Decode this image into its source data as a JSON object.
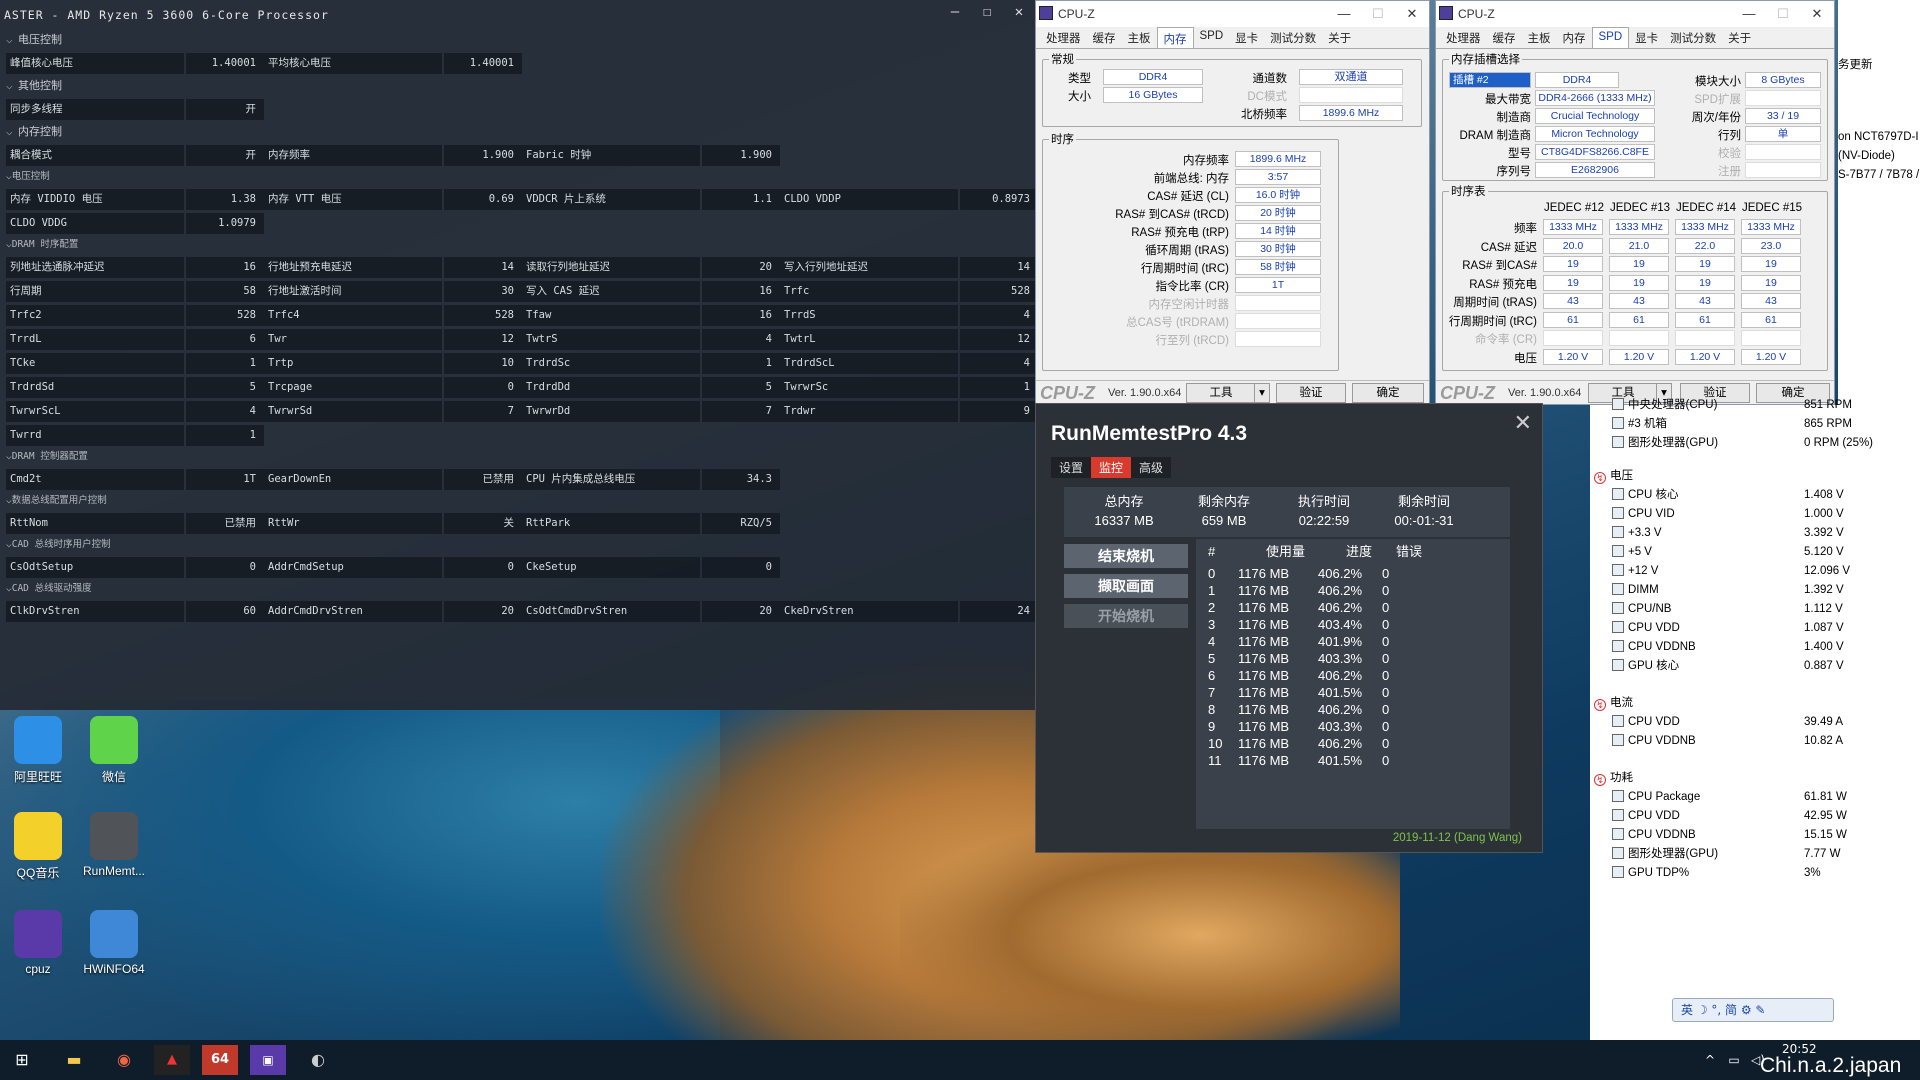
{
  "ryzen_master": {
    "title": "ASTER - AMD Ryzen 5 3600 6-Core Processor",
    "sections": [
      {
        "heading": "电压控制",
        "size": "big",
        "rows": [
          [
            [
              "峰值核心电压",
              "1.40001"
            ],
            [
              "平均核心电压",
              "1.40001"
            ]
          ]
        ]
      },
      {
        "heading": "其他控制",
        "size": "big",
        "rows": [
          [
            [
              "同步多线程",
              "开"
            ]
          ]
        ]
      },
      {
        "heading": "内存控制",
        "size": "big",
        "rows": [
          [
            [
              "耦合模式",
              "开"
            ],
            [
              "内存频率",
              "1.900"
            ],
            [
              "Fabric 时钟",
              "1.900"
            ]
          ]
        ]
      },
      {
        "heading": "电压控制",
        "size": "small",
        "rows": [
          [
            [
              "内存 VIDDIO 电压",
              "1.38"
            ],
            [
              "内存 VTT 电压",
              "0.69"
            ],
            [
              "VDDCR 片上系统",
              "1.1"
            ],
            [
              "CLDO VDDP",
              "0.8973"
            ]
          ],
          [
            [
              "CLDO VDDG",
              "1.0979"
            ]
          ]
        ]
      },
      {
        "heading": "DRAM 时序配置",
        "size": "small",
        "rows": [
          [
            [
              "列地址选通脉冲延迟",
              "16"
            ],
            [
              "行地址预充电延迟",
              "14"
            ],
            [
              "读取行列地址延迟",
              "20"
            ],
            [
              "写入行列地址延迟",
              "14"
            ]
          ],
          [
            [
              "行周期",
              "58"
            ],
            [
              "行地址激活时间",
              "30"
            ],
            [
              "写入 CAS 延迟",
              "16"
            ],
            [
              "Trfc",
              "528"
            ]
          ],
          [
            [
              "Trfc2",
              "528"
            ],
            [
              "Trfc4",
              "528"
            ],
            [
              "Tfaw",
              "16"
            ],
            [
              "TrrdS",
              "4"
            ]
          ],
          [
            [
              "TrrdL",
              "6"
            ],
            [
              "Twr",
              "12"
            ],
            [
              "TwtrS",
              "4"
            ],
            [
              "TwtrL",
              "12"
            ]
          ],
          [
            [
              "TCke",
              "1"
            ],
            [
              "Trtp",
              "10"
            ],
            [
              "TrdrdSc",
              "1"
            ],
            [
              "TrdrdScL",
              "4"
            ]
          ],
          [
            [
              "TrdrdSd",
              "5"
            ],
            [
              "Trcpage",
              "0"
            ],
            [
              "TrdrdDd",
              "5"
            ],
            [
              "TwrwrSc",
              "1"
            ]
          ],
          [
            [
              "TwrwrScL",
              "4"
            ],
            [
              "TwrwrSd",
              "7"
            ],
            [
              "TwrwrDd",
              "7"
            ],
            [
              "Trdwr",
              "9"
            ]
          ],
          [
            [
              "Twrrd",
              "1"
            ]
          ]
        ]
      },
      {
        "heading": "DRAM 控制器配置",
        "size": "small",
        "rows": [
          [
            [
              "Cmd2t",
              "1T"
            ],
            [
              "GearDownEn",
              "已禁用"
            ],
            [
              "CPU 片内集成总线电压",
              "34.3"
            ]
          ]
        ]
      },
      {
        "heading": "数据总线配置用户控制",
        "size": "small",
        "rows": [
          [
            [
              "RttNom",
              "已禁用"
            ],
            [
              "RttWr",
              "关"
            ],
            [
              "RttPark",
              "RZQ/5"
            ]
          ]
        ]
      },
      {
        "heading": "CAD 总线时序用户控制",
        "size": "small",
        "rows": [
          [
            [
              "CsOdtSetup",
              "0"
            ],
            [
              "AddrCmdSetup",
              "0"
            ],
            [
              "CkeSetup",
              "0"
            ]
          ]
        ]
      },
      {
        "heading": "CAD 总线驱动强度",
        "size": "small",
        "rows": [
          [
            [
              "ClkDrvStren",
              "60"
            ],
            [
              "AddrCmdDrvStren",
              "20"
            ],
            [
              "CsOdtCmdDrvStren",
              "20"
            ],
            [
              "CkeDrvStren",
              "24"
            ]
          ]
        ]
      }
    ]
  },
  "cpuz1": {
    "title": "CPU-Z",
    "tabs": [
      "处理器",
      "缓存",
      "主板",
      "内存",
      "SPD",
      "显卡",
      "测试分数",
      "关于"
    ],
    "active_tab": 3,
    "general_label": "常规",
    "type_label": "类型",
    "type": "DDR4",
    "size_label": "大小",
    "size": "16 GBytes",
    "channels_label": "通道数",
    "channels": "双通道",
    "dc_label": "DC模式",
    "nb_label": "北桥频率",
    "nb": "1899.6 MHz",
    "timing_label": "时序",
    "timings": [
      {
        "k": "内存频率",
        "v": "1899.6 MHz",
        "dim": false
      },
      {
        "k": "前端总线: 内存",
        "v": "3:57",
        "dim": false
      },
      {
        "k": "CAS# 延迟 (CL)",
        "v": "16.0 时钟",
        "dim": false
      },
      {
        "k": "RAS# 到CAS# (tRCD)",
        "v": "20 时钟",
        "dim": false
      },
      {
        "k": "RAS# 预充电 (tRP)",
        "v": "14 时钟",
        "dim": false
      },
      {
        "k": "循环周期 (tRAS)",
        "v": "30 时钟",
        "dim": false
      },
      {
        "k": "行周期时间 (tRC)",
        "v": "58 时钟",
        "dim": false
      },
      {
        "k": "指令比率 (CR)",
        "v": "1T",
        "dim": false
      },
      {
        "k": "内存空闲计时器",
        "v": "",
        "dim": true
      },
      {
        "k": "总CAS号 (tRDRAM)",
        "v": "",
        "dim": true
      },
      {
        "k": "行至列 (tRCD)",
        "v": "",
        "dim": true
      }
    ],
    "footer_logo": "CPU-Z",
    "version": "Ver. 1.90.0.x64",
    "tools": "工具",
    "validate": "验证",
    "ok": "确定"
  },
  "cpuz2": {
    "title": "CPU-Z",
    "tabs": [
      "处理器",
      "缓存",
      "主板",
      "内存",
      "SPD",
      "显卡",
      "测试分数",
      "关于"
    ],
    "active_tab": 4,
    "slot_group": "内存插槽选择",
    "slot": "插槽 #2",
    "mem_type": "DDR4",
    "module_size_label": "模块大小",
    "module_size": "8 GBytes",
    "max_bw_label": "最大带宽",
    "max_bw": "DDR4-2666 (1333 MHz)",
    "spd_ext_label": "SPD扩展",
    "maker_label": "制造商",
    "maker": "Crucial Technology",
    "week_label": "周次/年份",
    "week": "33 / 19",
    "dram_maker_label": "DRAM 制造商",
    "dram_maker": "Micron Technology",
    "rank_label": "行列",
    "rank": "单",
    "part_label": "型号",
    "part": "CT8G4DFS8266.C8FE",
    "check_label": "校验",
    "serial_label": "序列号",
    "serial": "E2682906",
    "reg_label": "注册",
    "table_label": "时序表",
    "jedec_headers": [
      "JEDEC #12",
      "JEDEC #13",
      "JEDEC #14",
      "JEDEC #15"
    ],
    "jedec_rows": [
      {
        "k": "频率",
        "v": [
          "1333 MHz",
          "1333 MHz",
          "1333 MHz",
          "1333 MHz"
        ]
      },
      {
        "k": "CAS# 延迟",
        "v": [
          "20.0",
          "21.0",
          "22.0",
          "23.0"
        ]
      },
      {
        "k": "RAS# 到CAS#",
        "v": [
          "19",
          "19",
          "19",
          "19"
        ]
      },
      {
        "k": "RAS# 预充电",
        "v": [
          "19",
          "19",
          "19",
          "19"
        ]
      },
      {
        "k": "周期时间 (tRAS)",
        "v": [
          "43",
          "43",
          "43",
          "43"
        ]
      },
      {
        "k": "行周期时间 (tRC)",
        "v": [
          "61",
          "61",
          "61",
          "61"
        ]
      },
      {
        "k": "命令率 (CR)",
        "v": [
          "",
          "",
          "",
          ""
        ],
        "dim": true
      },
      {
        "k": "电压",
        "v": [
          "1.20 V",
          "1.20 V",
          "1.20 V",
          "1.20 V"
        ]
      }
    ],
    "footer_logo": "CPU-Z",
    "version": "Ver. 1.90.0.x64",
    "tools": "工具",
    "validate": "验证",
    "ok": "确定"
  },
  "runmemtest": {
    "title": "RunMemtestPro 4.3",
    "tabs": [
      "设置",
      "监控",
      "高级"
    ],
    "active_tab": 1,
    "summary_headers": [
      "总内存",
      "剩余内存",
      "执行时间",
      "剩余时间"
    ],
    "summary_values": [
      "16337 MB",
      "659 MB",
      "02:22:59",
      "00:-01:-31"
    ],
    "buttons": [
      "结束烧机",
      "撷取画面",
      "开始烧机"
    ],
    "table_headers": [
      "#",
      "使用量",
      "进度",
      "错误"
    ],
    "rows": [
      [
        "0",
        "1176 MB",
        "406.2%",
        "0"
      ],
      [
        "1",
        "1176 MB",
        "406.2%",
        "0"
      ],
      [
        "2",
        "1176 MB",
        "406.2%",
        "0"
      ],
      [
        "3",
        "1176 MB",
        "403.4%",
        "0"
      ],
      [
        "4",
        "1176 MB",
        "401.9%",
        "0"
      ],
      [
        "5",
        "1176 MB",
        "403.3%",
        "0"
      ],
      [
        "6",
        "1176 MB",
        "406.2%",
        "0"
      ],
      [
        "7",
        "1176 MB",
        "401.5%",
        "0"
      ],
      [
        "8",
        "1176 MB",
        "406.2%",
        "0"
      ],
      [
        "9",
        "1176 MB",
        "403.3%",
        "0"
      ],
      [
        "10",
        "1176 MB",
        "406.2%",
        "0"
      ],
      [
        "11",
        "1176 MB",
        "401.5%",
        "0"
      ]
    ],
    "footer": "2019-11-12 (Dang Wang)"
  },
  "hwinfo_partial": {
    "right_top_texts": [
      "务更新",
      "on NCT6797D-I",
      "(NV-Diode)",
      "S-7B77 / 7B78 /"
    ],
    "fans": [
      {
        "k": "中央处理器(CPU)",
        "v": "851 RPM"
      },
      {
        "k": "#3 机箱",
        "v": "865 RPM"
      },
      {
        "k": "图形处理器(GPU)",
        "v": "0 RPM  (25%)"
      }
    ],
    "voltage_heading": "电压",
    "voltages": [
      {
        "k": "CPU 核心",
        "v": "1.408 V"
      },
      {
        "k": "CPU VID",
        "v": "1.000 V"
      },
      {
        "k": "+3.3 V",
        "v": "3.392 V"
      },
      {
        "k": "+5 V",
        "v": "5.120 V"
      },
      {
        "k": "+12 V",
        "v": "12.096 V"
      },
      {
        "k": "DIMM",
        "v": "1.392 V"
      },
      {
        "k": "CPU/NB",
        "v": "1.112 V"
      },
      {
        "k": "CPU VDD",
        "v": "1.087 V"
      },
      {
        "k": "CPU VDDNB",
        "v": "1.400 V"
      },
      {
        "k": "GPU 核心",
        "v": "0.887 V"
      }
    ],
    "current_heading": "电流",
    "currents": [
      {
        "k": "CPU VDD",
        "v": "39.49 A"
      },
      {
        "k": "CPU VDDNB",
        "v": "10.82 A"
      }
    ],
    "power_heading": "功耗",
    "powers": [
      {
        "k": "CPU Package",
        "v": "61.81 W"
      },
      {
        "k": "CPU VDD",
        "v": "42.95 W"
      },
      {
        "k": "CPU VDDNB",
        "v": "15.15 W"
      },
      {
        "k": "图形处理器(GPU)",
        "v": "7.77 W"
      },
      {
        "k": "GPU TDP%",
        "v": "3%"
      }
    ]
  },
  "desktop_icons": [
    {
      "label": "阿里旺旺",
      "color": "#2d8fe6"
    },
    {
      "label": "微信",
      "color": "#5fd34a"
    },
    {
      "label": "QQ音乐",
      "color": "#f4d02a"
    },
    {
      "label": "RunMemt...",
      "color": "#505458"
    },
    {
      "label": "cpuz",
      "color": "#5a3aa8"
    },
    {
      "label": "HWiNFO64",
      "color": "#3f88d8"
    }
  ],
  "ime": "英 ☽ °, 简 ⚙ ✎",
  "clock": "20:52",
  "watermark": "Chi.n.a.2.japan"
}
